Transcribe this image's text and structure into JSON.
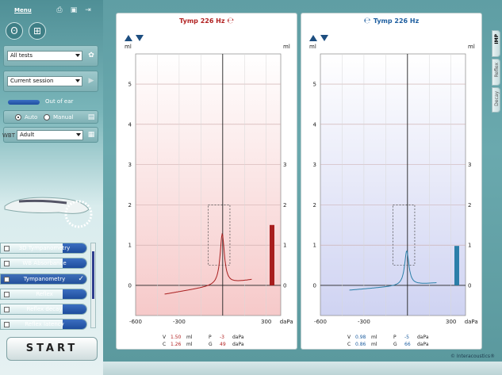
{
  "menu": {
    "label": "Menu",
    "icons": [
      "print-icon",
      "save-icon",
      "exit-icon"
    ]
  },
  "left": {
    "test_selector": "All tests",
    "session_selector": "Current session",
    "out_of_ear": "Out of ear",
    "mode_auto": "Auto",
    "mode_manual": "Manual",
    "wbt_label": "WBT",
    "wbt_selector": "Adult",
    "tests": [
      {
        "label": "3D Tympanometry",
        "selected": false,
        "checked": false
      },
      {
        "label": "WB Absorbance",
        "selected": false,
        "checked": false
      },
      {
        "label": "Tympanometry",
        "selected": true,
        "checked": true
      },
      {
        "label": "Reflex",
        "selected": false,
        "checked": false
      },
      {
        "label": "Reflex decay",
        "selected": false,
        "checked": false
      },
      {
        "label": "Reflex latency",
        "selected": false,
        "checked": false
      }
    ],
    "start": "START"
  },
  "left_graph": {
    "title": "Tymp 226 Hz",
    "ear_color": "#b22222",
    "unit_left": "ml",
    "unit_right": "ml",
    "results": {
      "V_label": "V",
      "V_val": "1.50",
      "V_unit": "ml",
      "C_label": "C",
      "C_val": "1.26",
      "C_unit": "ml",
      "P_label": "P",
      "P_val": "-3",
      "P_unit": "daPa",
      "G_label": "G",
      "G_val": "49",
      "G_unit": "daPa"
    }
  },
  "right_graph": {
    "title": "Tymp 226 Hz",
    "ear_color": "#1f5fa0",
    "unit_left": "ml",
    "unit_right": "ml",
    "results": {
      "V_label": "V",
      "V_val": "0.98",
      "V_unit": "ml",
      "C_label": "C",
      "C_val": "0.86",
      "C_unit": "ml",
      "P_label": "P",
      "P_val": "-5",
      "P_unit": "daPa",
      "G_label": "G",
      "G_val": "66",
      "G_unit": "daPa"
    }
  },
  "axis": {
    "y_ticks_left": [
      "5",
      "4",
      "3",
      "2",
      "1",
      "0"
    ],
    "y_ticks_right": [
      "3",
      "2",
      "1",
      "0"
    ],
    "x_ticks": [
      "-600",
      "-300",
      "300"
    ],
    "x_unit": "daPa"
  },
  "right_tabs": [
    "IMP",
    "Reflex",
    "Decay"
  ],
  "copyright": "© Interacoustics®"
}
